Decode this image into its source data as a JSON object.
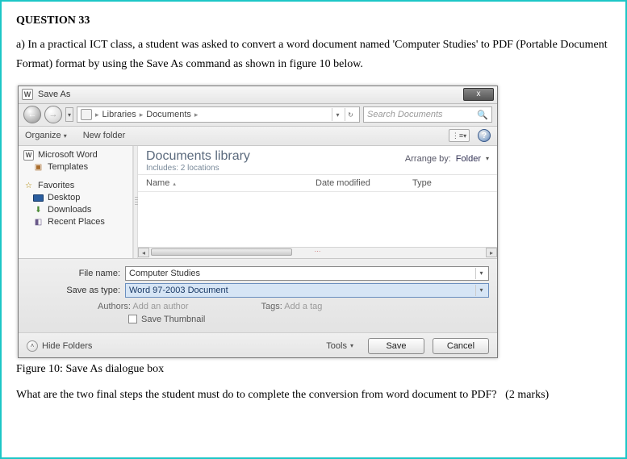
{
  "question": {
    "title": "QUESTION 33",
    "body_a": "a) In a practical ICT class, a student was asked to convert a word document named 'Computer Studies' to PDF (Portable Document Format) format by using the Save As command as shown in figure 10 below.",
    "final": "What are the two final steps the student must do to complete the conversion from word document to PDF?",
    "marks": "(2 marks)"
  },
  "figure_caption": "Figure 10: Save As dialogue box",
  "dialog": {
    "title": "Save As",
    "close_label": "x",
    "breadcrumb": {
      "seg1": "Libraries",
      "seg2": "Documents"
    },
    "search_placeholder": "Search Documents",
    "toolbar": {
      "organize": "Organize",
      "new_folder": "New folder",
      "help": "?"
    },
    "sidebar": {
      "ms_word": "Microsoft Word",
      "templates": "Templates",
      "favorites": "Favorites",
      "desktop": "Desktop",
      "downloads": "Downloads",
      "recent": "Recent Places"
    },
    "library": {
      "title": "Documents library",
      "subtitle": "Includes:  2 locations",
      "arrange_label": "Arrange by:",
      "arrange_value": "Folder"
    },
    "columns": {
      "name": "Name",
      "date": "Date modified",
      "type": "Type"
    },
    "fields": {
      "file_name_label": "File name:",
      "file_name_value": "Computer Studies",
      "save_type_label": "Save as type:",
      "save_type_value": "Word 97-2003 Document",
      "authors_label": "Authors:",
      "authors_value": "Add an author",
      "tags_label": "Tags:",
      "tags_value": "Add a tag",
      "save_thumbnail": "Save Thumbnail"
    },
    "buttons": {
      "hide_folders": "Hide Folders",
      "tools": "Tools",
      "save": "Save",
      "cancel": "Cancel"
    }
  }
}
